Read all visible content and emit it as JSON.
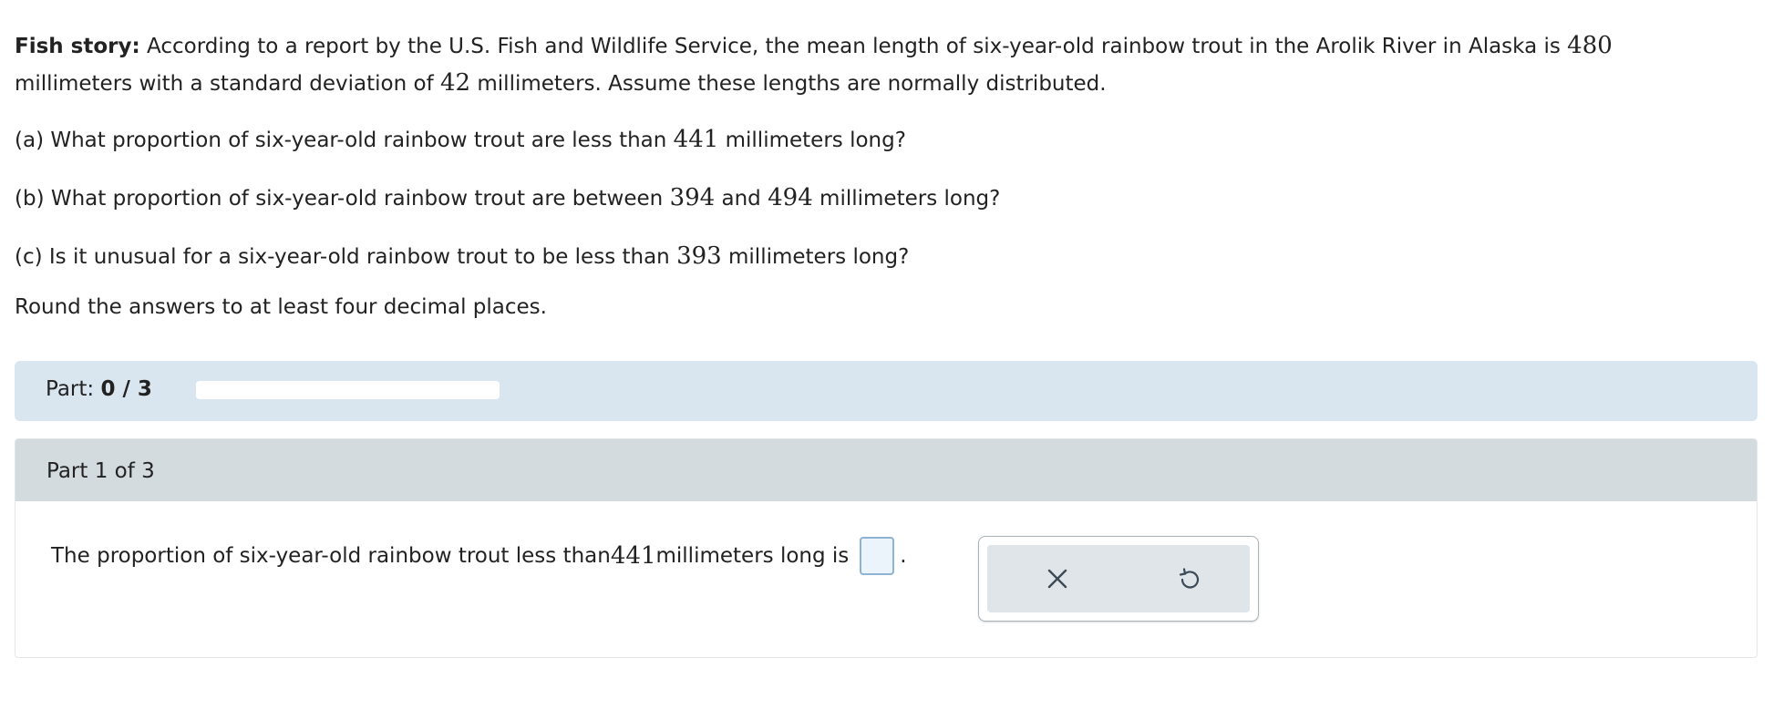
{
  "problem": {
    "heading": "Fish story:",
    "intro_text_1": " According to a report by the U.S. Fish and Wildlife Service, the mean length of six-year-old rainbow trout in the Arolik River in Alaska is ",
    "mean": "480",
    "intro_text_2": " millimeters with a standard deviation of ",
    "std_dev": "42",
    "intro_text_3": " millimeters. Assume these lengths are normally distributed.",
    "qa_prefix": "(a) What proportion of six-year-old rainbow trout are less than ",
    "qa_value": "441",
    "qa_suffix": " millimeters long?",
    "qb_prefix": "(b) What proportion of six-year-old rainbow trout are between ",
    "qb_value_1": "394",
    "qb_and": " and ",
    "qb_value_2": "494",
    "qb_suffix": " millimeters long?",
    "qc_prefix": "(c) Is it unusual for a six-year-old rainbow trout to be less than ",
    "qc_value": "393",
    "qc_suffix": " millimeters long?",
    "rounding_note": "Round the answers to at least four decimal places."
  },
  "progress": {
    "label": "Part: ",
    "value_text": "0 / 3",
    "fraction": 0
  },
  "part_card": {
    "title": "Part 1 of 3",
    "answer_prefix": "The proportion of six-year-old rainbow trout less than ",
    "answer_value": "441",
    "answer_suffix": " millimeters long is",
    "answer_input_value": "",
    "period": "."
  },
  "tools": {
    "clear_icon": "close-icon",
    "undo_icon": "undo-icon"
  },
  "colors": {
    "part_bar": "#dae6ef",
    "card_header": "#d3dbdf",
    "input_border": "#8fb3d3",
    "icon": "#3b4a56"
  }
}
